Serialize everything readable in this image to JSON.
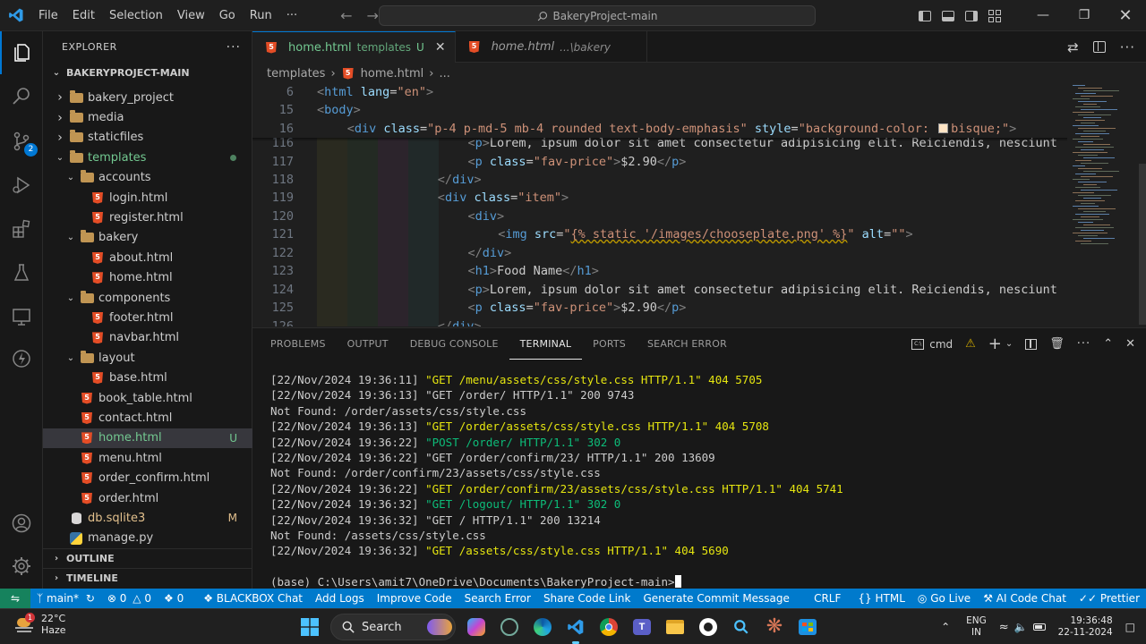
{
  "titlebar": {
    "menus": [
      "File",
      "Edit",
      "Selection",
      "View",
      "Go",
      "Run"
    ],
    "overflow": "···",
    "search_text": "BakeryProject-main",
    "brand_color": "#0078d4"
  },
  "activity_bar": {
    "icons": [
      "explorer-icon",
      "search-icon",
      "source-control-icon",
      "run-debug-icon",
      "extensions-icon",
      "testing-icon",
      "remote-explorer-icon",
      "blackbox-icon",
      "accounts-icon",
      "manage-gear-icon"
    ],
    "source_control_badge": "2"
  },
  "sidebar": {
    "title": "EXPLORER",
    "root": "BAKERYPROJECT-MAIN",
    "items": [
      {
        "label": "bakery_project",
        "type": "folder",
        "depth": 1,
        "expanded": false
      },
      {
        "label": "media",
        "type": "folder",
        "depth": 1,
        "expanded": false
      },
      {
        "label": "staticfiles",
        "type": "folder",
        "depth": 1,
        "expanded": false
      },
      {
        "label": "templates",
        "type": "folder",
        "depth": 1,
        "expanded": true,
        "dot": true
      },
      {
        "label": "accounts",
        "type": "folder",
        "depth": 2,
        "expanded": true
      },
      {
        "label": "login.html",
        "type": "html",
        "depth": 3
      },
      {
        "label": "register.html",
        "type": "html",
        "depth": 3
      },
      {
        "label": "bakery",
        "type": "folder",
        "depth": 2,
        "expanded": true
      },
      {
        "label": "about.html",
        "type": "html",
        "depth": 3
      },
      {
        "label": "home.html",
        "type": "html",
        "depth": 3
      },
      {
        "label": "components",
        "type": "folder",
        "depth": 2,
        "expanded": true
      },
      {
        "label": "footer.html",
        "type": "html",
        "depth": 3
      },
      {
        "label": "navbar.html",
        "type": "html",
        "depth": 3
      },
      {
        "label": "layout",
        "type": "folder",
        "depth": 2,
        "expanded": true
      },
      {
        "label": "base.html",
        "type": "html",
        "depth": 3
      },
      {
        "label": "book_table.html",
        "type": "html",
        "depth": 2
      },
      {
        "label": "contact.html",
        "type": "html",
        "depth": 2
      },
      {
        "label": "home.html",
        "type": "html",
        "depth": 2,
        "selected": true,
        "status": "U"
      },
      {
        "label": "menu.html",
        "type": "html",
        "depth": 2
      },
      {
        "label": "order_confirm.html",
        "type": "html",
        "depth": 2
      },
      {
        "label": "order.html",
        "type": "html",
        "depth": 2
      },
      {
        "label": "db.sqlite3",
        "type": "db",
        "depth": 1,
        "status": "M"
      },
      {
        "label": "manage.py",
        "type": "py",
        "depth": 1
      }
    ],
    "outline": "OUTLINE",
    "timeline": "TIMELINE"
  },
  "editor": {
    "tabs": [
      {
        "label": "home.html",
        "desc": "templates",
        "status": "U",
        "active": true
      },
      {
        "label": "home.html",
        "desc": "...\\bakery",
        "active": false
      }
    ],
    "breadcrumb": [
      "templates",
      "home.html",
      "..."
    ],
    "sticky_lines": [
      {
        "ln": "6",
        "parts": [
          [
            "br",
            "<"
          ],
          [
            "tag",
            "html"
          ],
          [
            "txt",
            " "
          ],
          [
            "attr",
            "lang"
          ],
          [
            "txt",
            "="
          ],
          [
            "str",
            "\"en\""
          ],
          [
            "br",
            ">"
          ]
        ],
        "indent": 0
      },
      {
        "ln": "15",
        "parts": [
          [
            "br",
            "<"
          ],
          [
            "tag",
            "body"
          ],
          [
            "br",
            ">"
          ]
        ],
        "indent": 0
      },
      {
        "ln": "16",
        "parts": [
          [
            "br",
            "<"
          ],
          [
            "tag",
            "div"
          ],
          [
            "txt",
            " "
          ],
          [
            "attr",
            "class"
          ],
          [
            "txt",
            "="
          ],
          [
            "str",
            "\"p-4 p-md-5 mb-4 rounded text-body-emphasis\""
          ],
          [
            "txt",
            " "
          ],
          [
            "attr",
            "style"
          ],
          [
            "txt",
            "="
          ],
          [
            "str",
            "\"background-color: "
          ],
          [
            "swatch",
            ""
          ],
          [
            "str",
            "bisque;\""
          ],
          [
            "br",
            ">"
          ]
        ],
        "indent": 1
      }
    ],
    "lines": [
      {
        "ln": "116",
        "parts": [
          [
            "br",
            "<"
          ],
          [
            "tag",
            "p"
          ],
          [
            "br",
            ">"
          ],
          [
            "txt",
            "Lorem, ipsum dolor sit amet consectetur adipisicing elit. Reiciendis, nesciunt"
          ]
        ],
        "indent": 5
      },
      {
        "ln": "117",
        "parts": [
          [
            "br",
            "<"
          ],
          [
            "tag",
            "p"
          ],
          [
            "txt",
            " "
          ],
          [
            "attr",
            "class"
          ],
          [
            "txt",
            "="
          ],
          [
            "str",
            "\"fav-price\""
          ],
          [
            "br",
            ">"
          ],
          [
            "txt",
            "$2.90"
          ],
          [
            "br",
            "</"
          ],
          [
            "tag",
            "p"
          ],
          [
            "br",
            ">"
          ]
        ],
        "indent": 5
      },
      {
        "ln": "118",
        "parts": [
          [
            "br",
            "</"
          ],
          [
            "tag",
            "div"
          ],
          [
            "br",
            ">"
          ]
        ],
        "indent": 4
      },
      {
        "ln": "119",
        "parts": [
          [
            "br",
            "<"
          ],
          [
            "tag",
            "div"
          ],
          [
            "txt",
            " "
          ],
          [
            "attr",
            "class"
          ],
          [
            "txt",
            "="
          ],
          [
            "str",
            "\"item\""
          ],
          [
            "br",
            ">"
          ]
        ],
        "indent": 4
      },
      {
        "ln": "120",
        "parts": [
          [
            "br",
            "<"
          ],
          [
            "tag",
            "div"
          ],
          [
            "br",
            ">"
          ]
        ],
        "indent": 5
      },
      {
        "ln": "121",
        "parts": [
          [
            "br",
            "<"
          ],
          [
            "tag",
            "img"
          ],
          [
            "txt",
            " "
          ],
          [
            "attr",
            "src"
          ],
          [
            "txt",
            "="
          ],
          [
            "str",
            "\""
          ],
          [
            "tpl",
            "{% static '/images/chooseplate.png' %}"
          ],
          [
            "str",
            "\""
          ],
          [
            "txt",
            " "
          ],
          [
            "attr",
            "alt"
          ],
          [
            "txt",
            "="
          ],
          [
            "str",
            "\"\""
          ],
          [
            "br",
            ">"
          ]
        ],
        "indent": 6
      },
      {
        "ln": "122",
        "parts": [
          [
            "br",
            "</"
          ],
          [
            "tag",
            "div"
          ],
          [
            "br",
            ">"
          ]
        ],
        "indent": 5
      },
      {
        "ln": "123",
        "parts": [
          [
            "br",
            "<"
          ],
          [
            "tag",
            "h1"
          ],
          [
            "br",
            ">"
          ],
          [
            "txt",
            "Food Name"
          ],
          [
            "br",
            "</"
          ],
          [
            "tag",
            "h1"
          ],
          [
            "br",
            ">"
          ]
        ],
        "indent": 5
      },
      {
        "ln": "124",
        "parts": [
          [
            "br",
            "<"
          ],
          [
            "tag",
            "p"
          ],
          [
            "br",
            ">"
          ],
          [
            "txt",
            "Lorem, ipsum dolor sit amet consectetur adipisicing elit. Reiciendis, nesciunt"
          ]
        ],
        "indent": 5
      },
      {
        "ln": "125",
        "parts": [
          [
            "br",
            "<"
          ],
          [
            "tag",
            "p"
          ],
          [
            "txt",
            " "
          ],
          [
            "attr",
            "class"
          ],
          [
            "txt",
            "="
          ],
          [
            "str",
            "\"fav-price\""
          ],
          [
            "br",
            ">"
          ],
          [
            "txt",
            "$2.90"
          ],
          [
            "br",
            "</"
          ],
          [
            "tag",
            "p"
          ],
          [
            "br",
            ">"
          ]
        ],
        "indent": 5
      },
      {
        "ln": "126",
        "parts": [
          [
            "br",
            "</"
          ],
          [
            "tag",
            "div"
          ],
          [
            "br",
            ">"
          ]
        ],
        "indent": 4
      }
    ]
  },
  "panel": {
    "tabs": [
      "PROBLEMS",
      "OUTPUT",
      "DEBUG CONSOLE",
      "TERMINAL",
      "PORTS",
      "SEARCH ERROR"
    ],
    "active_tab": "TERMINAL",
    "terminal_shell": "cmd",
    "terminal_lines": [
      [
        [
          "w",
          "[22/Nov/2024 19:36:11] "
        ],
        [
          "y",
          "\"GET /menu/assets/css/style.css HTTP/1.1\" 404 5705"
        ]
      ],
      [
        [
          "w",
          "[22/Nov/2024 19:36:13] \"GET /order/ HTTP/1.1\" 200 9743"
        ]
      ],
      [
        [
          "w",
          "Not Found: /order/assets/css/style.css"
        ]
      ],
      [
        [
          "w",
          "[22/Nov/2024 19:36:13] "
        ],
        [
          "y",
          "\"GET /order/assets/css/style.css HTTP/1.1\" 404 5708"
        ]
      ],
      [
        [
          "w",
          "[22/Nov/2024 19:36:22] "
        ],
        [
          "g",
          "\"POST /order/ HTTP/1.1\" 302 0"
        ]
      ],
      [
        [
          "w",
          "[22/Nov/2024 19:36:22] \"GET /order/confirm/23/ HTTP/1.1\" 200 13609"
        ]
      ],
      [
        [
          "w",
          "Not Found: /order/confirm/23/assets/css/style.css"
        ]
      ],
      [
        [
          "w",
          "[22/Nov/2024 19:36:22] "
        ],
        [
          "y",
          "\"GET /order/confirm/23/assets/css/style.css HTTP/1.1\" 404 5741"
        ]
      ],
      [
        [
          "w",
          "[22/Nov/2024 19:36:32] "
        ],
        [
          "g",
          "\"GET /logout/ HTTP/1.1\" 302 0"
        ]
      ],
      [
        [
          "w",
          "[22/Nov/2024 19:36:32] \"GET / HTTP/1.1\" 200 13214"
        ]
      ],
      [
        [
          "w",
          "Not Found: /assets/css/style.css"
        ]
      ],
      [
        [
          "w",
          "[22/Nov/2024 19:36:32] "
        ],
        [
          "y",
          "\"GET /assets/css/style.css HTTP/1.1\" 404 5690"
        ]
      ],
      [
        [
          "w",
          ""
        ]
      ],
      [
        [
          "w",
          "(base) C:\\Users\\amit7\\OneDrive\\Documents\\BakeryProject-main>"
        ]
      ]
    ]
  },
  "statusbar": {
    "branch": "main*",
    "errors": "0",
    "warnings": "0",
    "ports": "0",
    "left_items": [
      "BLACKBOX Chat",
      "Add Logs",
      "Improve Code",
      "Search Error",
      "Share Code Link",
      "Generate Commit Message"
    ],
    "eol": "CRLF",
    "language": "HTML",
    "go_live": "Go Live",
    "ai_chat": "AI Code Chat",
    "prettier": "Prettier",
    "bg_color": "#007acc"
  },
  "taskbar": {
    "weather_temp": "22°C",
    "weather_desc": "Haze",
    "weather_badge": "1",
    "search_label": "Search",
    "lang_line1": "ENG",
    "lang_line2": "IN",
    "time": "19:36:48",
    "date": "22-11-2024"
  }
}
